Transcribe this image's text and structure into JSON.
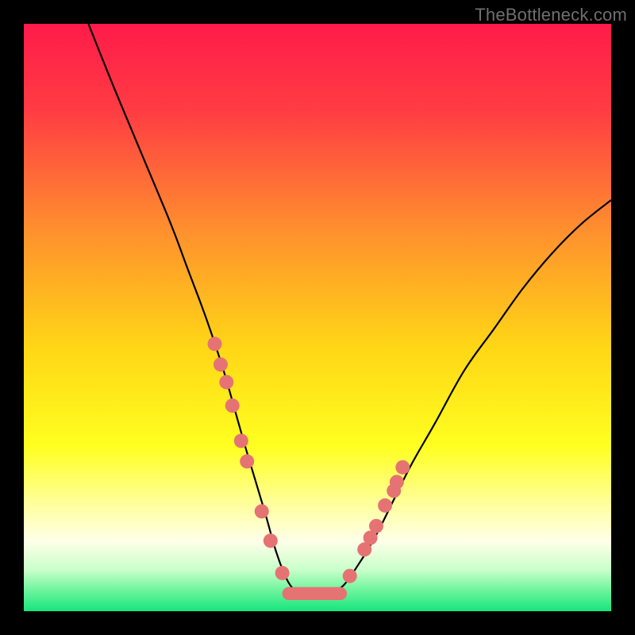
{
  "watermark": "TheBottleneck.com",
  "chart_data": {
    "type": "line",
    "title": "",
    "xlabel": "",
    "ylabel": "",
    "xlim": [
      0,
      100
    ],
    "ylim": [
      0,
      100
    ],
    "background_gradient": {
      "stops": [
        {
          "offset": 0.0,
          "color": "#ff1b4a"
        },
        {
          "offset": 0.15,
          "color": "#ff3d43"
        },
        {
          "offset": 0.35,
          "color": "#ff8f2e"
        },
        {
          "offset": 0.55,
          "color": "#ffd616"
        },
        {
          "offset": 0.72,
          "color": "#ffff20"
        },
        {
          "offset": 0.82,
          "color": "#ffffa0"
        },
        {
          "offset": 0.88,
          "color": "#ffffe8"
        },
        {
          "offset": 0.93,
          "color": "#c8ffca"
        },
        {
          "offset": 0.965,
          "color": "#6cf49c"
        },
        {
          "offset": 1.0,
          "color": "#16e57e"
        }
      ]
    },
    "series": [
      {
        "name": "bottleneck-curve",
        "type": "line",
        "color": "#000000",
        "x": [
          11,
          15,
          20,
          25,
          28,
          31,
          34,
          36,
          38,
          41,
          43,
          45,
          47,
          49,
          51,
          54,
          57,
          60,
          63,
          66,
          70,
          75,
          80,
          85,
          90,
          95,
          100
        ],
        "y": [
          100,
          90,
          78,
          66,
          58,
          50,
          41,
          34,
          27,
          17,
          10,
          5,
          3,
          3,
          3,
          4,
          8,
          13,
          19,
          25,
          32,
          41,
          48,
          55,
          61,
          66,
          70
        ]
      },
      {
        "name": "left-cluster-points",
        "type": "scatter",
        "color": "#e57373",
        "x": [
          32.5,
          33.5,
          34.5,
          35.5,
          37.0,
          38.0,
          40.5,
          42.0,
          44.0
        ],
        "y": [
          45.5,
          42.0,
          39.0,
          35.0,
          29.0,
          25.5,
          17.0,
          12.0,
          6.5
        ]
      },
      {
        "name": "right-cluster-points",
        "type": "scatter",
        "color": "#e57373",
        "x": [
          55.5,
          58.0,
          59.0,
          60.0,
          61.5,
          63.0,
          63.5,
          64.5
        ],
        "y": [
          6.0,
          10.5,
          12.5,
          14.5,
          18.0,
          20.5,
          22.0,
          24.5
        ]
      },
      {
        "name": "bottom-bar",
        "type": "bar-segment",
        "color": "#e57373",
        "x_start": 44.0,
        "x_end": 55.0,
        "y": 3.0,
        "thickness_pct": 2.2
      }
    ]
  }
}
